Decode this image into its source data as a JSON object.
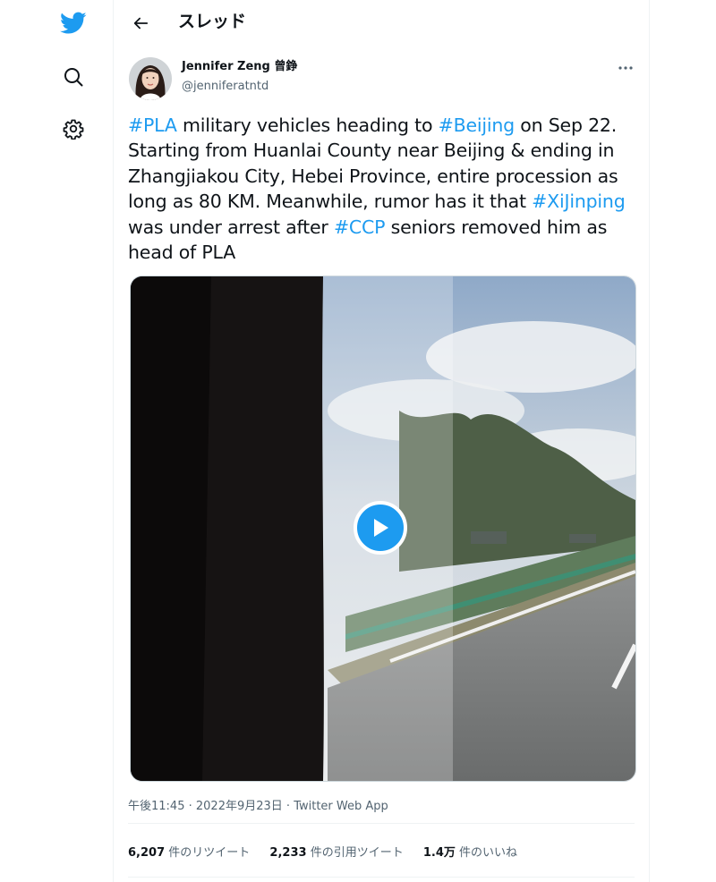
{
  "nav": {
    "items": [
      {
        "name": "twitter-logo",
        "icon": "bird"
      },
      {
        "name": "search",
        "icon": "magnifier"
      },
      {
        "name": "settings",
        "icon": "gear"
      }
    ]
  },
  "header": {
    "title": "スレッド"
  },
  "tweet": {
    "author_name": "Jennifer Zeng 曾錚",
    "author_handle": "@jenniferatntd",
    "text_lines": [
      [
        {
          "t": "#PLA",
          "tag": true
        },
        {
          "t": " military vehicles heading to ",
          "tag": false
        },
        {
          "t": "#Beijing",
          "tag": true
        },
        {
          "t": " on Sep 22.",
          "tag": false
        }
      ],
      [
        {
          "t": "Starting from Huanlai County near Beijing & ending in",
          "tag": false
        }
      ],
      [
        {
          "t": "Zhangjiakou City, Hebei Province, entire procession as",
          "tag": false
        }
      ],
      [
        {
          "t": "long as 80 KM. Meanwhile, rumor has it that ",
          "tag": false
        },
        {
          "t": "#XiJinping",
          "tag": true
        }
      ],
      [
        {
          "t": "was under arrest after ",
          "tag": false
        },
        {
          "t": "#CCP",
          "tag": true
        },
        {
          "t": " seniors removed him as",
          "tag": false
        }
      ],
      [
        {
          "t": "head of PLA",
          "tag": false
        }
      ]
    ],
    "meta": {
      "time": "午後11:45",
      "date": "2022年9月23日",
      "source": "Twitter Web App",
      "separator": " · "
    },
    "stats": [
      {
        "count": "6,207",
        "label": "件のリツイート"
      },
      {
        "count": "2,233",
        "label": "件の引用ツイート"
      },
      {
        "count": "1.4万",
        "label": "件のいいね"
      }
    ]
  },
  "colors": {
    "accent": "#1d9bf0",
    "text": "#0f1419",
    "secondary": "#536471",
    "border": "#eff3f4"
  }
}
